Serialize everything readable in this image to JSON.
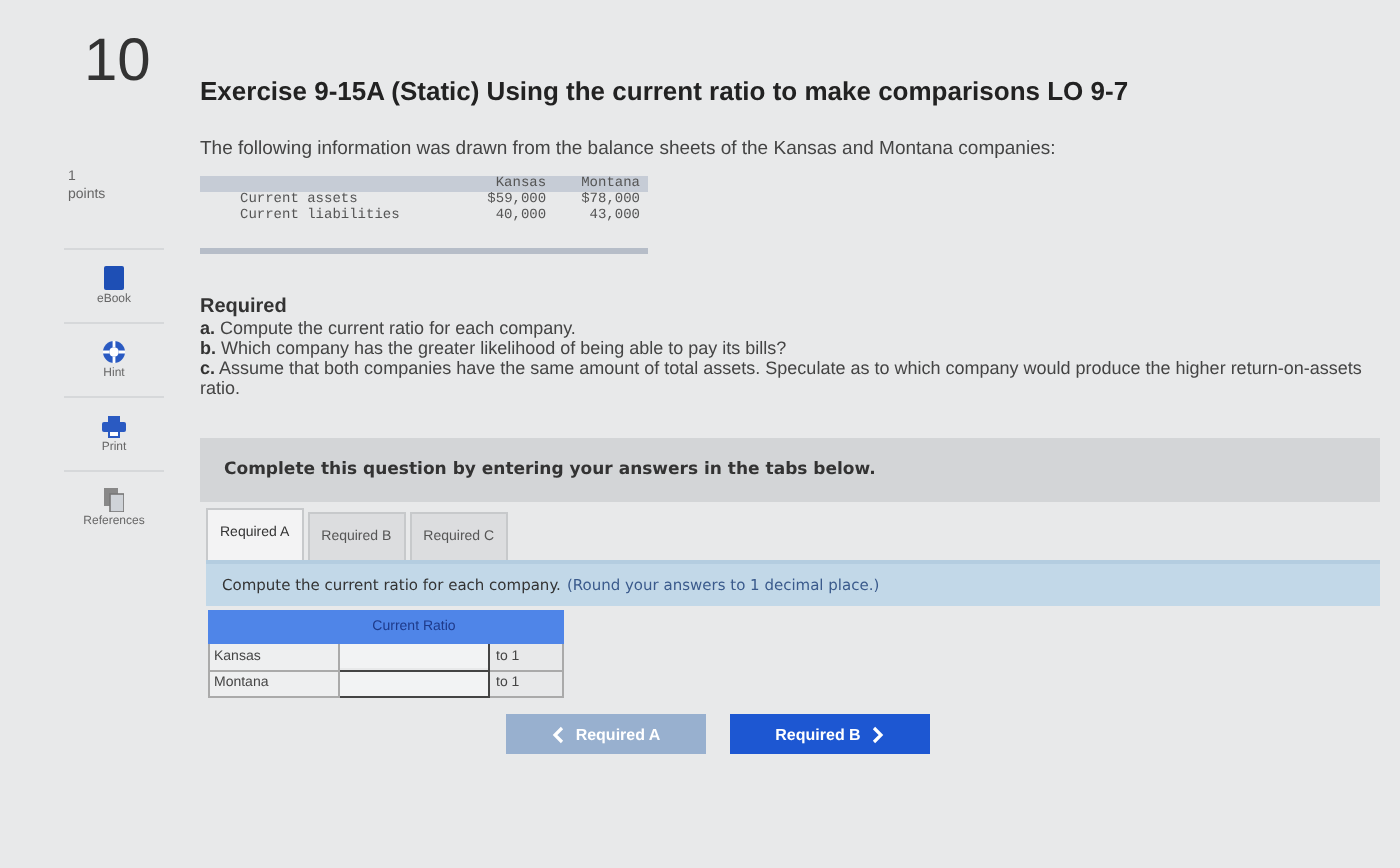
{
  "question": {
    "number": "10",
    "points": "1",
    "points_label": "points"
  },
  "tools": [
    {
      "kind": "ebook",
      "label": "eBook"
    },
    {
      "kind": "hint",
      "label": "Hint"
    },
    {
      "kind": "print",
      "label": "Print"
    },
    {
      "kind": "references",
      "label": "References"
    }
  ],
  "title": "Exercise 9-15A (Static) Using the current ratio to make comparisons LO 9-7",
  "intro": "The following information was drawn from the balance sheets of the Kansas and Montana companies:",
  "data_table": {
    "columns": [
      "Kansas",
      "Montana"
    ],
    "rows": [
      {
        "label": "Current assets",
        "values": [
          "$59,000",
          "$78,000"
        ]
      },
      {
        "label": "Current liabilities",
        "values": [
          "40,000",
          "43,000"
        ]
      }
    ]
  },
  "required": {
    "heading": "Required",
    "items": [
      "**a.** Compute the current ratio for each company.",
      "**b.** Which company has the greater likelihood of being able to pay its bills?",
      "**c.** Assume that both companies have the same amount of total assets. Speculate as to which company would produce the higher return-on-assets ratio."
    ]
  },
  "instruction_box": "Complete this question by entering your answers in the tabs below.",
  "tabs": [
    {
      "label": "Required A",
      "selected": true
    },
    {
      "label": "Required B",
      "selected": false
    },
    {
      "label": "Required C",
      "selected": false
    }
  ],
  "prompt": {
    "text": "Compute the current ratio for each company.",
    "note": "(Round your answers to 1 decimal place.)"
  },
  "answer_table": {
    "header": "Current Ratio",
    "rows": [
      {
        "label": "Kansas",
        "suffix": "to 1"
      },
      {
        "label": "Montana",
        "suffix": "to 1"
      }
    ]
  },
  "nav_buttons": [
    {
      "kind": "prev",
      "label": "Required A",
      "disabled": true
    },
    {
      "kind": "next",
      "label": "Required B",
      "disabled": false
    }
  ]
}
